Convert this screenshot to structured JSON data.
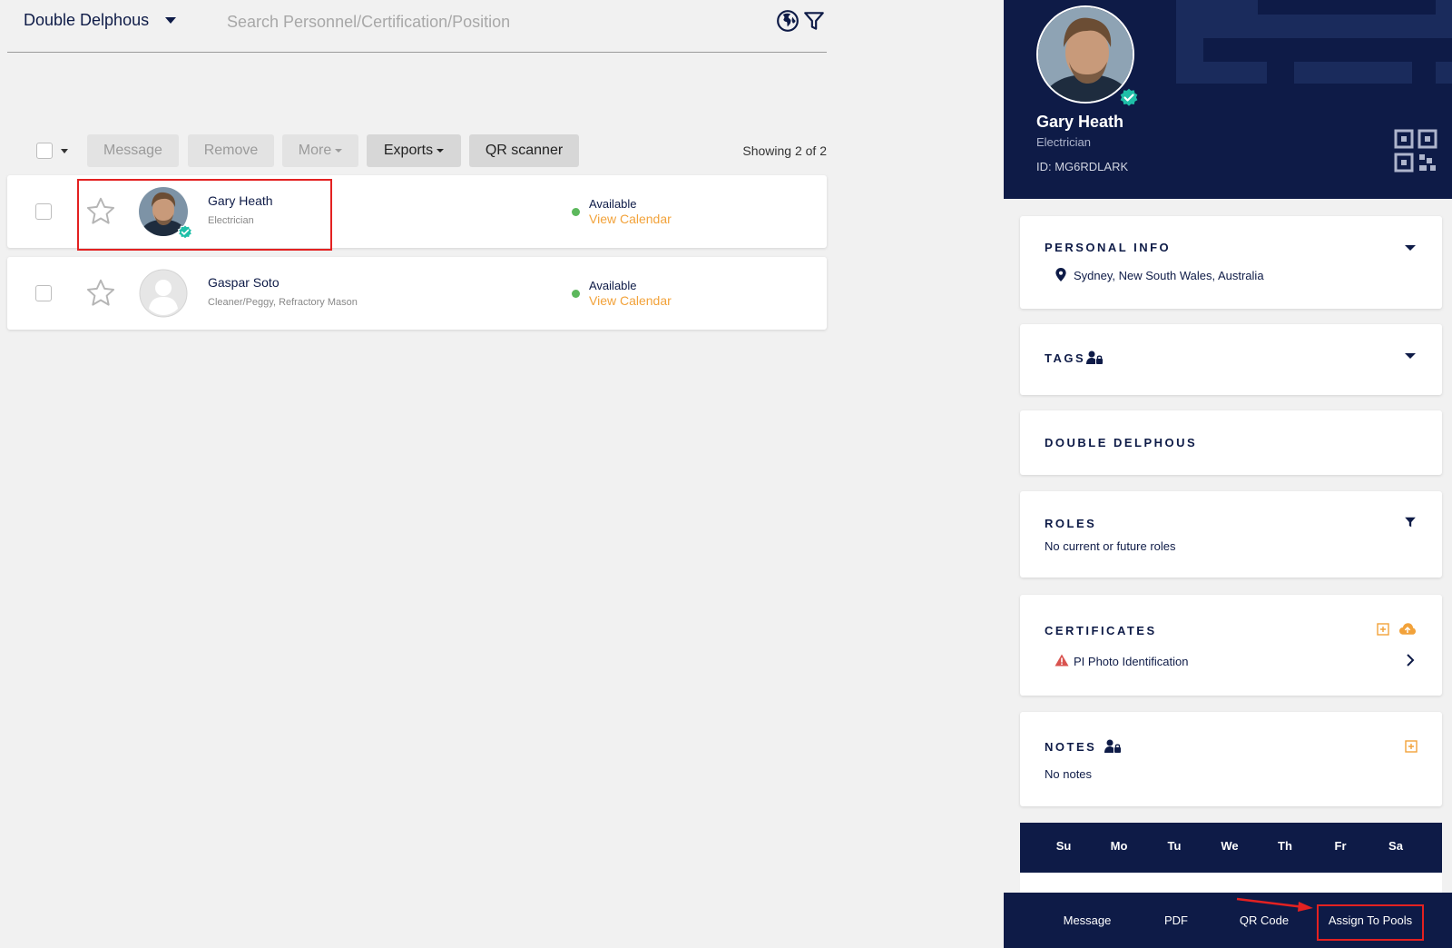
{
  "header": {
    "org_name": "Double Delphous",
    "search_placeholder": "Search Personnel/Certification/Position"
  },
  "toolbar": {
    "message": "Message",
    "remove": "Remove",
    "more": "More",
    "exports": "Exports",
    "qr_scanner": "QR scanner",
    "showing": "Showing 2 of 2"
  },
  "personnel": [
    {
      "name": "Gary Heath",
      "role": "Electrician",
      "status": "Available",
      "calendar_link": "View Calendar",
      "verified": true
    },
    {
      "name": "Gaspar Soto",
      "role": "Cleaner/Peggy, Refractory Mason",
      "status": "Available",
      "calendar_link": "View Calendar",
      "verified": false
    }
  ],
  "profile": {
    "name": "Gary Heath",
    "role": "Electrician",
    "id_label": "ID: MG6RDLARK",
    "personal_info": {
      "title": "PERSONAL INFO",
      "location": "Sydney, New South Wales, Australia"
    },
    "tags": {
      "title": "TAGS"
    },
    "org": {
      "title": "DOUBLE DELPHOUS"
    },
    "roles": {
      "title": "ROLES",
      "text": "No current or future roles"
    },
    "certificates": {
      "title": "CERTIFICATES",
      "items": [
        "PI Photo Identification"
      ]
    },
    "notes": {
      "title": "NOTES",
      "text": "No notes"
    },
    "calendar_days": [
      "Su",
      "Mo",
      "Tu",
      "We",
      "Th",
      "Fr",
      "Sa"
    ],
    "actions": {
      "message": "Message",
      "pdf": "PDF",
      "qr_code": "QR Code",
      "assign_pools": "Assign To Pools"
    }
  },
  "colors": {
    "navy": "#0e1b47",
    "accent_orange": "#f2a23a",
    "available_green": "#5cb85c",
    "verified_teal": "#1fbfa8",
    "warning_red": "#d9534f",
    "annotation_red": "#e32121"
  }
}
